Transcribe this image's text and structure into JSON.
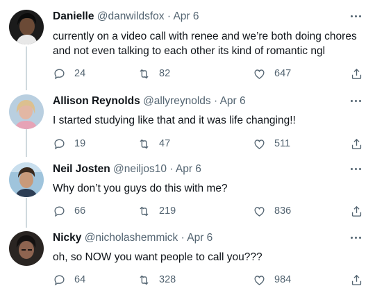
{
  "tweets": [
    {
      "name": "Danielle",
      "handle": "@danwildsfox",
      "date": "Apr 6",
      "text": "currently on a video call with renee and we’re both doing chores and not even talking to each other its kind of romantic ngl",
      "replies": "24",
      "retweets": "82",
      "likes": "647"
    },
    {
      "name": "Allison Reynolds",
      "handle": "@allyreynolds",
      "date": "Apr 6",
      "text": "I started studying like that and it was life changing!!",
      "replies": "19",
      "retweets": "47",
      "likes": "511"
    },
    {
      "name": "Neil Josten",
      "handle": "@neiljos10",
      "date": "Apr 6",
      "text": "Why don’t you guys do this with me?",
      "replies": "66",
      "retweets": "219",
      "likes": "836"
    },
    {
      "name": "Nicky",
      "handle": "@nicholashemmick",
      "date": "Apr 6",
      "text": "oh, so NOW you want people to call you???",
      "replies": "64",
      "retweets": "328",
      "likes": "984"
    }
  ],
  "separator": "·",
  "icons": {
    "reply": "reply-icon",
    "retweet": "retweet-icon",
    "like": "heart-icon",
    "share": "share-icon",
    "more": "more-options-icon"
  },
  "colors": {
    "text": "#0f1419",
    "secondary": "#536471",
    "thread_line": "#cfd9de"
  }
}
